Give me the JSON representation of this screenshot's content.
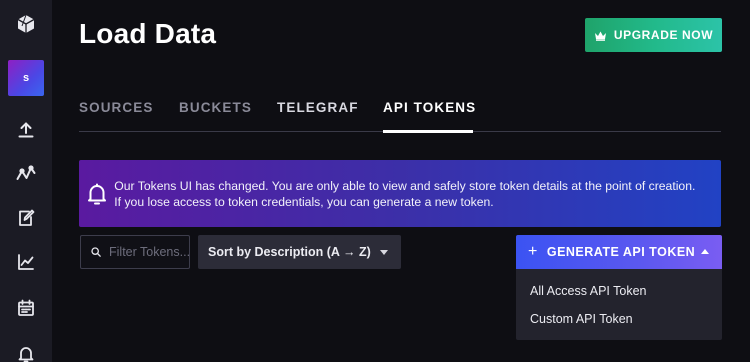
{
  "sidebar": {
    "logo_icon": "cube-logo-icon",
    "avatar_initial": "s",
    "items": [
      {
        "name": "upload",
        "icon": "upload-icon"
      },
      {
        "name": "tasks",
        "icon": "graph-node-icon"
      },
      {
        "name": "notebooks",
        "icon": "edit-icon"
      },
      {
        "name": "dashboards",
        "icon": "line-chart-icon"
      },
      {
        "name": "schedule",
        "icon": "calendar-icon"
      },
      {
        "name": "alerts",
        "icon": "bell-icon"
      }
    ]
  },
  "header": {
    "title": "Load Data",
    "upgrade_label": "UPGRADE NOW"
  },
  "tabs": [
    {
      "label": "SOURCES",
      "active": false
    },
    {
      "label": "BUCKETS",
      "active": false
    },
    {
      "label": "TELEGRAF",
      "active": false
    },
    {
      "label": "API TOKENS",
      "active": true
    }
  ],
  "banner": {
    "icon": "bell-icon",
    "text": "Our Tokens UI has changed. You are only able to view and safely store token details at the point of creation. If you lose access to token credentials, you can generate a new token."
  },
  "controls": {
    "search_placeholder": "Filter Tokens...",
    "sort_label": "Sort by Description (A → Z)",
    "generate_label": "GENERATE API TOKEN",
    "menu_items": [
      "All Access API Token",
      "Custom API Token"
    ]
  },
  "colors": {
    "upgrade": "#22b98a",
    "generate": "#5b58f0",
    "banner_start": "#5a1aa0",
    "banner_end": "#2142c4"
  }
}
